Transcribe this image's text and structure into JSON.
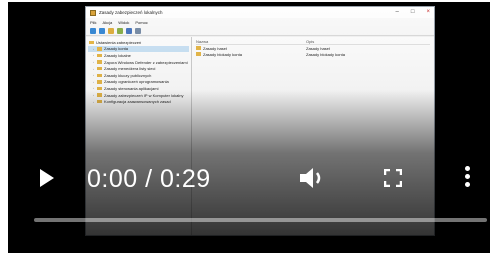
{
  "video_window": {
    "title": "Zasady zabezpieczeń lokalnych",
    "menu": [
      "Plik",
      "Akcja",
      "Widok",
      "Pomoc"
    ],
    "tree": [
      {
        "label": "Ustawienia zabezpieczeń",
        "indent": false,
        "selected": false
      },
      {
        "label": "Zasady konta",
        "indent": true,
        "selected": true
      },
      {
        "label": "Zasady lokalne",
        "indent": true,
        "selected": false
      },
      {
        "label": "Zapora Windows Defender z zabezpieczeniami",
        "indent": true,
        "selected": false
      },
      {
        "label": "Zasady menedżera listy sieci",
        "indent": true,
        "selected": false
      },
      {
        "label": "Zasady kluczy publicznych",
        "indent": true,
        "selected": false
      },
      {
        "label": "Zasady ograniczeń oprogramowania",
        "indent": true,
        "selected": false
      },
      {
        "label": "Zasady sterowania aplikacjami",
        "indent": true,
        "selected": false
      },
      {
        "label": "Zasady zabezpieczeń IP w Komputer lokalny",
        "indent": true,
        "selected": false
      },
      {
        "label": "Konfiguracja zaawansowanych zasad",
        "indent": true,
        "selected": false
      }
    ],
    "list_headers": {
      "name": "Nazwa",
      "description": "Opis"
    },
    "list_rows": [
      {
        "name": "Zasady haseł",
        "description": "Zasady haseł"
      },
      {
        "name": "Zasady blokady konta",
        "description": "Zasady blokady konta"
      }
    ]
  },
  "controls": {
    "current_time": "0:00",
    "separator": " / ",
    "duration": "0:29",
    "progress": 0.0,
    "icons": {
      "play": "play-icon",
      "volume": "volume-icon",
      "fullscreen": "fullscreen-icon",
      "more": "more-vertical-icon"
    },
    "color": "#ffffff"
  }
}
